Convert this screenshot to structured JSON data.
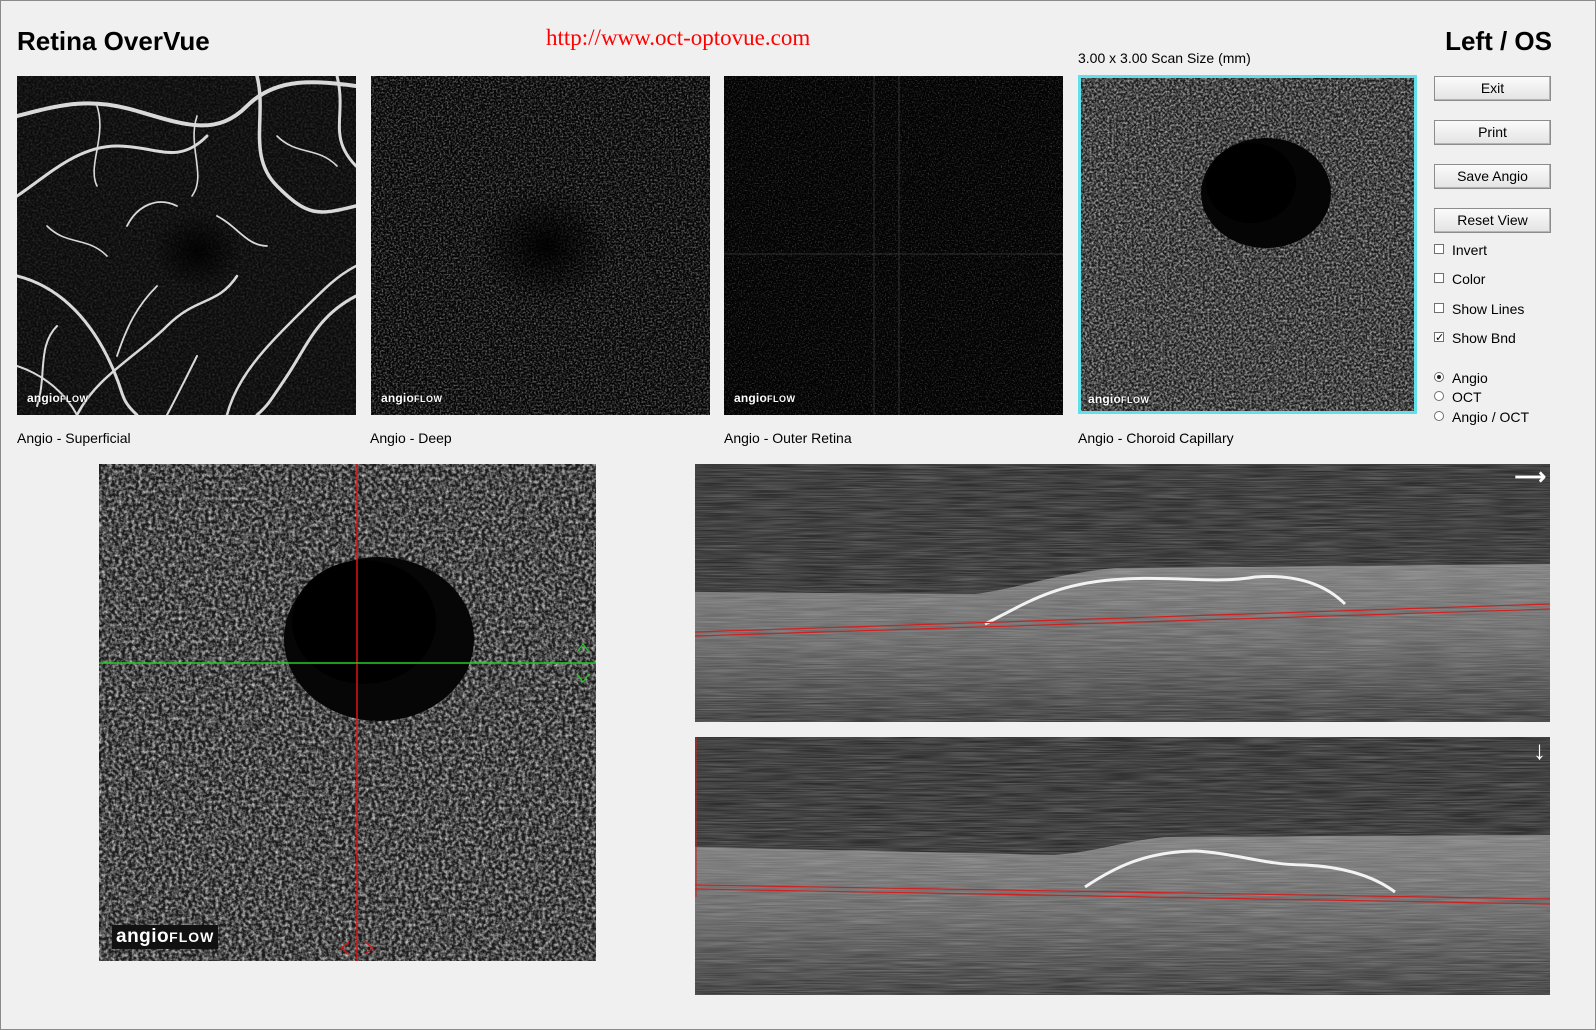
{
  "header": {
    "app_title": "Retina OverVue",
    "url": "http://www.oct-optovue.com",
    "eye": "Left / OS",
    "scan_size": "3.00 x 3.00 Scan Size (mm)"
  },
  "thumbnails": [
    {
      "caption": "Angio - Superficial",
      "logo_main": "angio",
      "logo_small": "FLOW"
    },
    {
      "caption": "Angio - Deep",
      "logo_main": "angio",
      "logo_small": "FLOW"
    },
    {
      "caption": "Angio - Outer Retina",
      "logo_main": "angio",
      "logo_small": "FLOW"
    },
    {
      "caption": "Angio - Choroid Capillary",
      "logo_main": "angio",
      "logo_small": "FLOW",
      "selected": true
    }
  ],
  "buttons": {
    "exit": "Exit",
    "print": "Print",
    "save_angio": "Save Angio",
    "reset_view": "Reset View"
  },
  "checkboxes": [
    {
      "label": "Invert",
      "checked": false
    },
    {
      "label": "Color",
      "checked": false
    },
    {
      "label": "Show Lines",
      "checked": false
    },
    {
      "label": "Show Bnd",
      "checked": true
    }
  ],
  "view_mode": {
    "options": [
      "Angio",
      "OCT",
      "Angio / OCT"
    ],
    "selected": "Angio"
  },
  "main_view": {
    "logo_main": "angio",
    "logo_small": "FLOW"
  },
  "colors": {
    "selected_border": "#5fe0ea",
    "url_red": "#ff0000",
    "crosshair_vertical": "#e01010",
    "crosshair_horizontal": "#22cc22",
    "boundary_line": "#d02020"
  },
  "icons": {
    "bscan_top": "arrow-right-icon",
    "bscan_bottom": "arrow-down-icon"
  }
}
